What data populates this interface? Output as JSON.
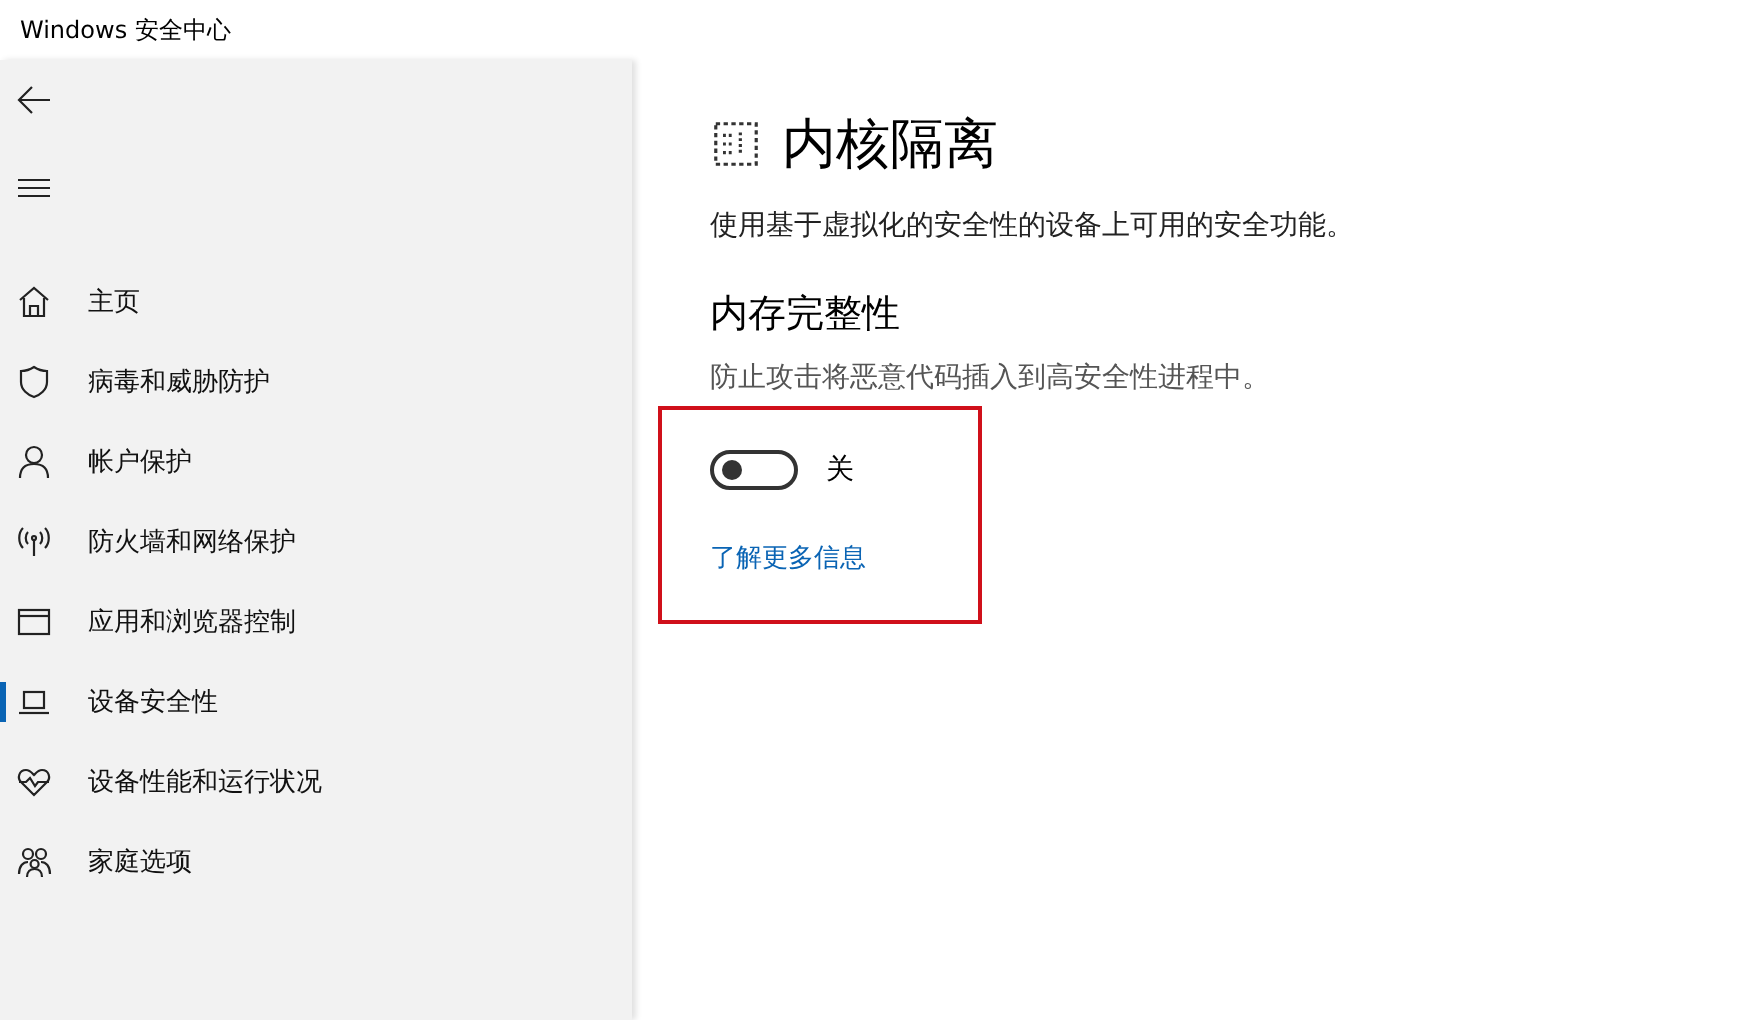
{
  "window": {
    "title": "Windows 安全中心"
  },
  "sidebar": {
    "items": [
      {
        "label": "主页",
        "selected": false
      },
      {
        "label": "病毒和威胁防护",
        "selected": false
      },
      {
        "label": "帐户保护",
        "selected": false
      },
      {
        "label": "防火墙和网络保护",
        "selected": false
      },
      {
        "label": "应用和浏览器控制",
        "selected": false
      },
      {
        "label": "设备安全性",
        "selected": true
      },
      {
        "label": "设备性能和运行状况",
        "selected": false
      },
      {
        "label": "家庭选项",
        "selected": false
      }
    ]
  },
  "page": {
    "title": "内核隔离",
    "description": "使用基于虚拟化的安全性的设备上可用的安全功能。",
    "section": {
      "title": "内存完整性",
      "description": "防止攻击将恶意代码插入到高安全性进程中。",
      "highlighted": true,
      "toggle": {
        "on": false,
        "label": "关"
      },
      "link": "了解更多信息"
    }
  }
}
